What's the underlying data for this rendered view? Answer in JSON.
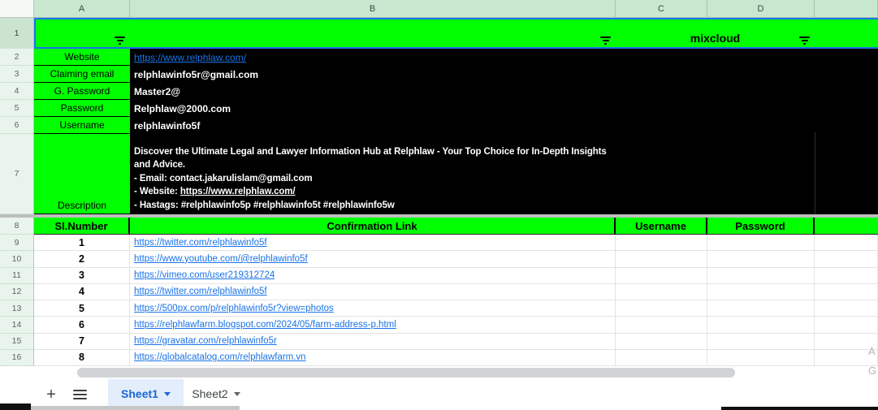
{
  "colors": {
    "bright_green": "#00ff00",
    "selection_blue": "#1a73e8",
    "link_blue": "#1a73e8",
    "column_header_green": "#c8e7cf",
    "black_fill": "#000000"
  },
  "column_headers": [
    "A",
    "B",
    "C",
    "D",
    ""
  ],
  "row_numbers": [
    "1",
    "2",
    "3",
    "4",
    "5",
    "6",
    "7",
    "8",
    "9",
    "10",
    "11",
    "12",
    "13",
    "14",
    "15",
    "16"
  ],
  "filter_row": {
    "merged_title": "mixcloud",
    "filter_icon": "filter-icon"
  },
  "profile": {
    "rows": [
      {
        "label": "Website",
        "value": "https://www.relphlaw.com/",
        "is_link": true
      },
      {
        "label": "Claiming email",
        "value": "relphlawinfo5r@gmail.com",
        "is_link": false
      },
      {
        "label": "G. Password",
        "value": "Master2@",
        "is_link": false
      },
      {
        "label": "Password",
        "value": "Relphlaw@2000.com",
        "is_link": false
      },
      {
        "label": "Username",
        "value": "relphlawinfo5f",
        "is_link": false
      }
    ],
    "description": {
      "label": "Description",
      "intro": "Discover the Ultimate Legal and Lawyer Information Hub at Relphlaw - Your Top Choice for In-Depth Insights and Advice.",
      "email_line": "- Email: contact.jakarulislam@gmail.com",
      "website_prefix": "- Website: ",
      "website_url": "https://www.relphlaw.com/",
      "hashtags_line": "- Hastags: #relphlawinfo5p #relphlawinfo5t #relphlawinfo5w"
    }
  },
  "links_table": {
    "headers": {
      "sl": "Sl.Number",
      "link": "Confirmation Link",
      "username": "Username",
      "password": "Password"
    },
    "rows": [
      {
        "sl": "1",
        "url": "https://twitter.com/relphlawinfo5f",
        "username": "",
        "password": ""
      },
      {
        "sl": "2",
        "url": "https://www.youtube.com/@relphlawinfo5f",
        "username": "",
        "password": ""
      },
      {
        "sl": "3",
        "url": "https://vimeo.com/user219312724",
        "username": "",
        "password": ""
      },
      {
        "sl": "4",
        "url": "https://twitter.com/relphlawinfo5f",
        "username": "",
        "password": ""
      },
      {
        "sl": "5",
        "url": "https://500px.com/p/relphlawinfo5r?view=photos",
        "username": "",
        "password": ""
      },
      {
        "sl": "6",
        "url": "https://relphlawfarm.blogspot.com/2024/05/farm-address-p.html",
        "username": "",
        "password": ""
      },
      {
        "sl": "7",
        "url": "https://gravatar.com/relphlawinfo5r",
        "username": "",
        "password": ""
      },
      {
        "sl": "8",
        "url": "https://globalcatalog.com/relphlawfarm.vn",
        "username": "",
        "password": ""
      }
    ]
  },
  "sheet_tabs": {
    "add_label": "+",
    "tabs": [
      {
        "name": "Sheet1",
        "active": true
      },
      {
        "name": "Sheet2",
        "active": false
      }
    ]
  },
  "edge_artifacts": [
    "A",
    "G"
  ]
}
